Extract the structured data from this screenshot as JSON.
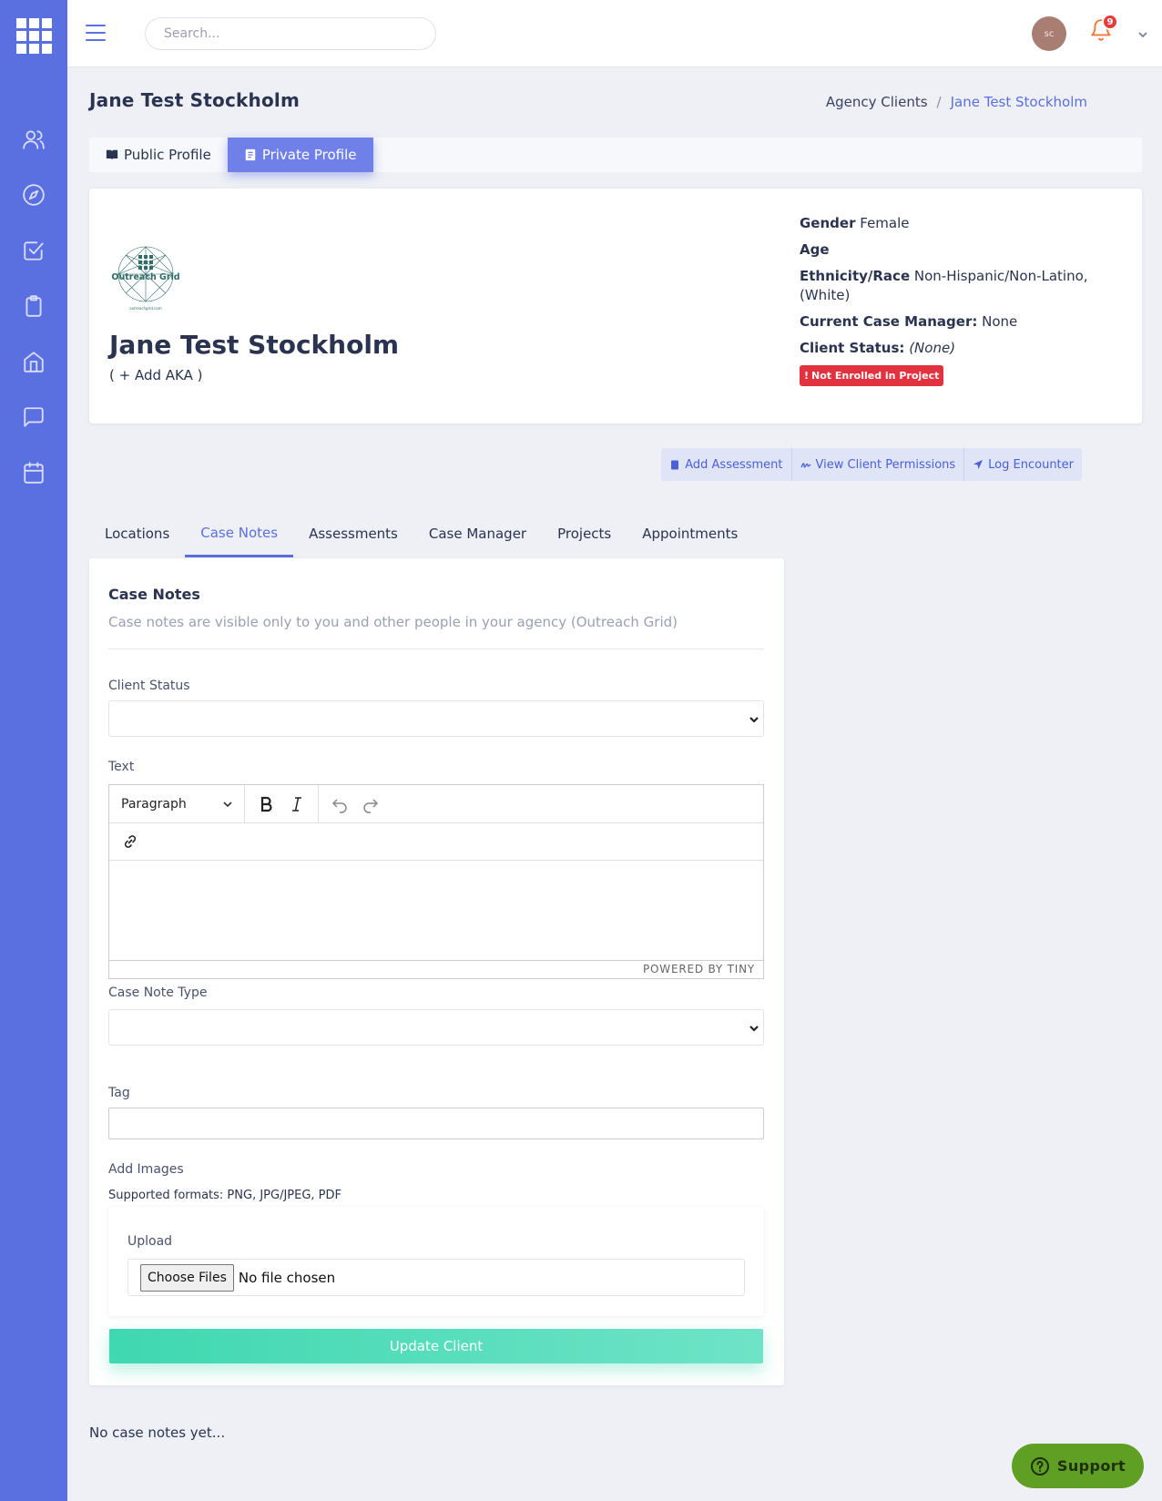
{
  "topbar": {
    "search_placeholder": "Search...",
    "avatar_initials": "sc",
    "notification_count": "9"
  },
  "page": {
    "title": "Jane Test Stockholm",
    "breadcrumb": [
      "Agency Clients",
      "/",
      "Jane Test Stockholm"
    ]
  },
  "profile_tabs": {
    "public": "Public Profile",
    "private": "Private Profile",
    "active": "private"
  },
  "client": {
    "name": "Jane Test Stockholm",
    "add_aka": "( + Add AKA )",
    "gender_label": "Gender",
    "gender": "Female",
    "age_label": "Age",
    "ethnicity_label": "Ethnicity/Race",
    "ethnicity": "Non-Hispanic/Non-Latino, (White)",
    "case_manager_label": "Current Case Manager:",
    "case_manager": "None",
    "status_label": "Client Status:",
    "status": "(None)",
    "enrollment_badge": "Not Enrolled in Project",
    "enrollment_color": "#e2323f"
  },
  "actions": {
    "add_assessment": "Add Assessment",
    "view_permissions": "View Client Permissions",
    "log_encounter": "Log Encounter"
  },
  "content_tabs": {
    "items": [
      "Locations",
      "Case Notes",
      "Assessments",
      "Case Manager",
      "Projects",
      "Appointments"
    ],
    "active": "Case Notes"
  },
  "case_notes": {
    "title": "Case Notes",
    "subtitle": "Case notes are visible only to you and other people in your agency (Outreach Grid)",
    "client_status_label": "Client Status",
    "client_status_value": "",
    "text_label": "Text",
    "editor_format": "Paragraph",
    "editor_branding": "POWERED BY TINY",
    "note_type_label": "Case Note Type",
    "note_type_value": "",
    "tag_label": "Tag",
    "tag_value": "",
    "add_images_label": "Add Images",
    "supported_formats": "Supported formats: PNG, JPG/JPEG, PDF",
    "upload_label": "Upload",
    "choose_files": "Choose Files",
    "file_status": "No file chosen",
    "update_button": "Update Client"
  },
  "footer": {
    "no_notes": "No case notes yet...",
    "support": "Support"
  },
  "colors": {
    "sidebar": "#5a6fe0",
    "accent": "#5a6fe0",
    "update_button": "#3fd8b0",
    "support_button": "#5fa024"
  }
}
